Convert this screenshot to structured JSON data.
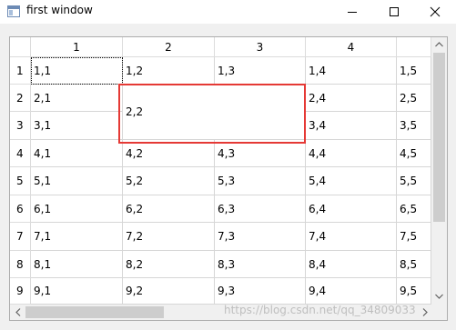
{
  "window": {
    "title": "first window",
    "icon": "app-window-icon",
    "controls": [
      "minimize-icon",
      "maximize-icon",
      "close-icon"
    ]
  },
  "table": {
    "columns": [
      "1",
      "2",
      "3",
      "4"
    ],
    "rows": [
      "1",
      "2",
      "3",
      "4",
      "5",
      "6",
      "7",
      "8",
      "9"
    ],
    "cells": [
      [
        "1,1",
        "1,2",
        "1,3",
        "1,4",
        "1,5"
      ],
      [
        "2,1",
        "2,2",
        "",
        "2,4",
        "2,5"
      ],
      [
        "3,1",
        "",
        "",
        "3,4",
        "3,5"
      ],
      [
        "4,1",
        "4,2",
        "4,3",
        "4,4",
        "4,5"
      ],
      [
        "5,1",
        "5,2",
        "5,3",
        "5,4",
        "5,5"
      ],
      [
        "6,1",
        "6,2",
        "6,3",
        "6,4",
        "6,5"
      ],
      [
        "7,1",
        "7,2",
        "7,3",
        "7,4",
        "7,5"
      ],
      [
        "8,1",
        "8,2",
        "8,3",
        "8,4",
        "8,5"
      ],
      [
        "9,1",
        "9,2",
        "9,3",
        "9,4",
        "9,5"
      ]
    ],
    "merged_cell": "2,2",
    "focused_cell": "1,1"
  },
  "watermark": "https://blog.csdn.net/qq_34809033",
  "colors": {
    "highlight_border": "#e53935",
    "grid_line": "#d6d6d6",
    "scroll_thumb": "#cdcdcd"
  }
}
